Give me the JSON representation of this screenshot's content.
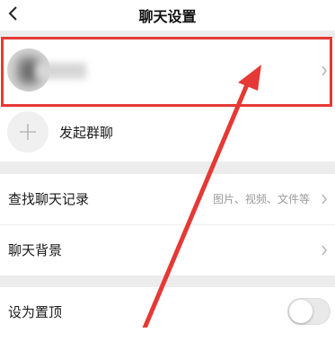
{
  "header": {
    "title": "聊天设置",
    "back_icon": "chevron-left-icon"
  },
  "contact": {
    "name": "",
    "chevron_icon": "chevron-right-icon"
  },
  "group_chat": {
    "label": "发起群聊",
    "icon": "plus-icon"
  },
  "search_history": {
    "label": "查找聊天记录",
    "hint": "图片、视频、文件等",
    "chevron_icon": "chevron-right-icon"
  },
  "chat_background": {
    "label": "聊天背景",
    "chevron_icon": "chevron-right-icon"
  },
  "pin_top": {
    "label": "设为置顶",
    "enabled": false
  },
  "annotation": {
    "color": "#e53935"
  }
}
